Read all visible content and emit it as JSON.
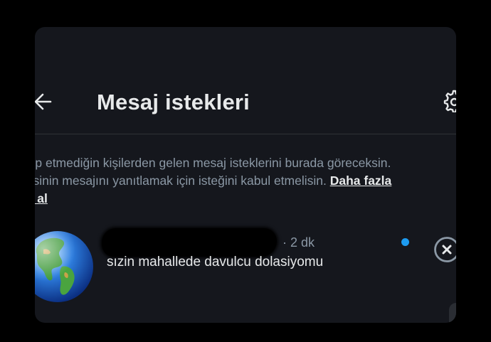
{
  "header": {
    "title": "Mesaj istekleri"
  },
  "info": {
    "line1": "akip etmediğin kişilerden gelen mesaj isteklerini burada göreceksin.",
    "line2_text": "arisinin mesajını yanıtlamak için isteğini kabul etmelisin. ",
    "line2_link": "Daha fazla",
    "line3_link": "lgi al"
  },
  "requests": [
    {
      "sender_name": "",
      "time": "· 2 dk",
      "message": "sızin mahallede davulcu dolasiyomu",
      "unread": true
    }
  ],
  "icons": {
    "back": "arrow-left-icon",
    "settings": "gear-icon",
    "avatar": "earth-globe-icon",
    "dismiss": "close-circle-icon"
  },
  "colors": {
    "panel_bg": "#15171d",
    "primary_text": "#e7e9ea",
    "secondary_text": "#8b98a5",
    "unread_dot": "#1d9bf0",
    "divider": "#2f3336"
  }
}
